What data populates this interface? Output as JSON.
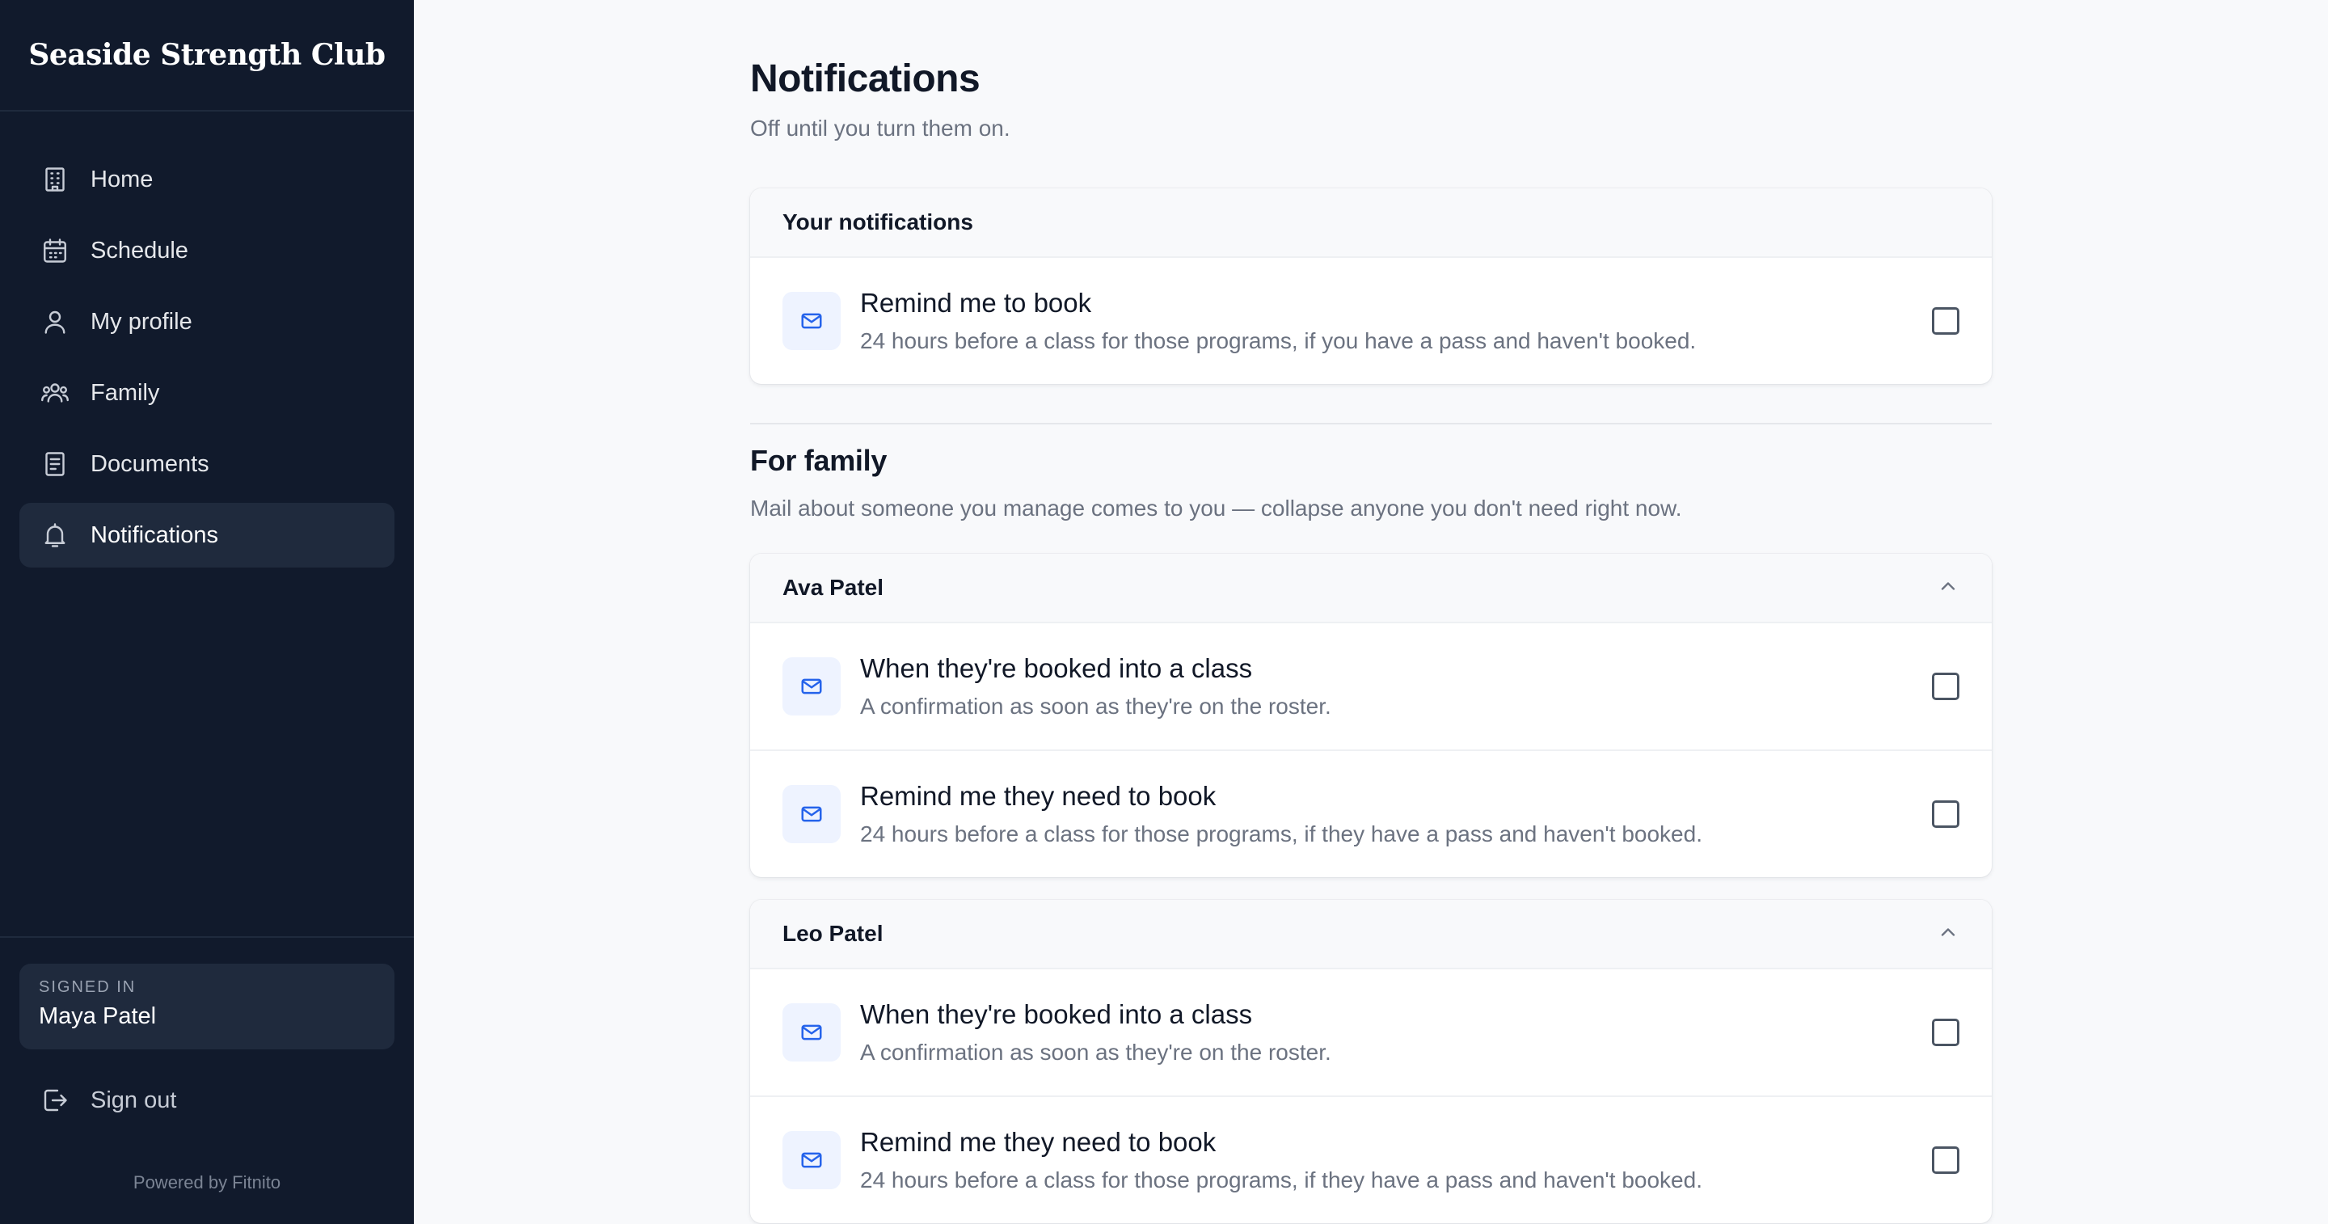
{
  "brand": {
    "name": "Seaside Strength Club"
  },
  "sidebar": {
    "items": [
      {
        "label": "Home",
        "icon": "building-icon"
      },
      {
        "label": "Schedule",
        "icon": "calendar-icon"
      },
      {
        "label": "My profile",
        "icon": "user-icon"
      },
      {
        "label": "Family",
        "icon": "users-icon"
      },
      {
        "label": "Documents",
        "icon": "document-icon"
      },
      {
        "label": "Notifications",
        "icon": "bell-icon",
        "active": true
      }
    ],
    "signed_in_caption": "SIGNED IN",
    "signed_in_name": "Maya Patel",
    "signout_label": "Sign out",
    "powered_by": "Powered by Fitnito"
  },
  "main": {
    "title": "Notifications",
    "subtitle": "Off until you turn them on.",
    "your_notifications": {
      "header": "Your notifications",
      "rows": [
        {
          "title": "Remind me to book",
          "desc": "24 hours before a class for those programs, if you have a pass and haven't booked.",
          "checked": false
        }
      ]
    },
    "family": {
      "title": "For family",
      "subtitle": "Mail about someone you manage comes to you — collapse anyone you don't need right now.",
      "members": [
        {
          "name": "Ava Patel",
          "expanded": true,
          "rows": [
            {
              "title": "When they're booked into a class",
              "desc": "A confirmation as soon as they're on the roster.",
              "checked": false
            },
            {
              "title": "Remind me they need to book",
              "desc": "24 hours before a class for those programs, if they have a pass and haven't booked.",
              "checked": false
            }
          ]
        },
        {
          "name": "Leo Patel",
          "expanded": true,
          "rows": [
            {
              "title": "When they're booked into a class",
              "desc": "A confirmation as soon as they're on the roster.",
              "checked": false
            },
            {
              "title": "Remind me they need to book",
              "desc": "24 hours before a class for those programs, if they have a pass and haven't booked.",
              "checked": false
            }
          ]
        }
      ]
    }
  },
  "colors": {
    "sidebar_bg": "#111a2c",
    "accent": "#2563eb",
    "page_bg": "#f8f9fb"
  }
}
